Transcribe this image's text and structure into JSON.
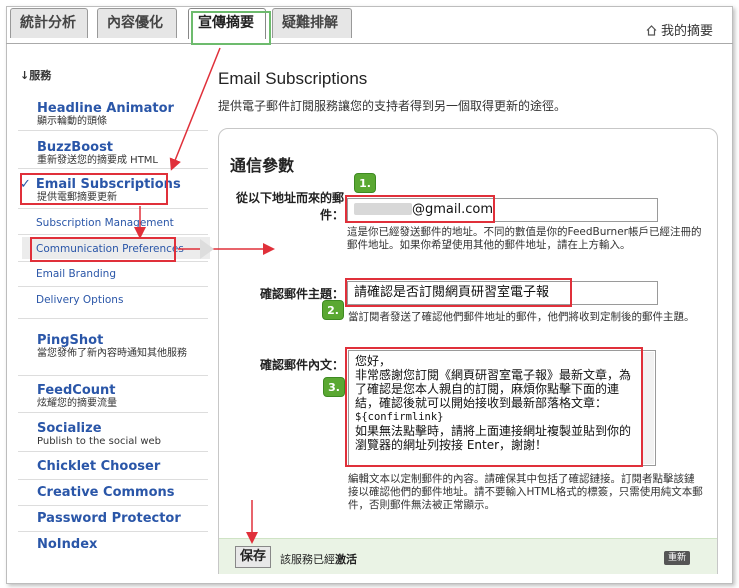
{
  "tabs": [
    {
      "label": "統計分析"
    },
    {
      "label": "內容優化"
    },
    {
      "label": "宣傳摘要"
    },
    {
      "label": "疑難排解"
    }
  ],
  "my_digest": "我的摘要",
  "sidebar": {
    "section_title": "↓服務",
    "services": [
      {
        "name": "Headline Animator",
        "desc": "顯示輪動的頭條"
      },
      {
        "name": "BuzzBoost",
        "desc": "重新發送您的摘要成 HTML"
      },
      {
        "name": "Email Subscriptions",
        "desc": "提供電郵摘要更新",
        "checked": "✓"
      },
      {
        "name": "PingShot",
        "desc": "當您發佈了新內容時通知其他服務"
      },
      {
        "name": "FeedCount",
        "desc": "炫耀您的摘要流量"
      },
      {
        "name": "Socialize",
        "desc": "Publish to the social web"
      },
      {
        "name": "Chicklet Chooser"
      },
      {
        "name": "Creative Commons"
      },
      {
        "name": "Password Protector"
      },
      {
        "name": "NoIndex"
      }
    ],
    "subitems": [
      {
        "label": "Subscription Management"
      },
      {
        "label": "Communication Preferences"
      },
      {
        "label": "Email Branding"
      },
      {
        "label": "Delivery Options"
      }
    ]
  },
  "main": {
    "title": "Email Subscriptions",
    "subtitle": "提供電子郵件訂閱服務讓您的支持者得到另一個取得更新的途徑。",
    "panel_title": "通信參數",
    "from_label": "從以下地址而來的郵件：",
    "from_value": "@gmail.com",
    "from_help": "這是你已經發送郵件的地址。不同的數值是你的FeedBurner帳戶已經注冊的郵件地址。如果你希望使用其他的郵件地址，請在上方輸入。",
    "subject_label": "確認郵件主題：",
    "subject_value": "請確認是否訂閱網頁研習室電子報",
    "subject_help": "當訂閱者發送了確認他們郵件地址的郵件，他們將收到定制後的郵件主題。",
    "body_label": "確認郵件內文：",
    "body_lines": [
      "您好，",
      "非常感謝您訂閱《網頁研習室電子報》最新文章，為了確認是您本人親自的訂閱，麻煩你點擊下面的連結，確認後就可以開始接收到最新部落格文章：",
      "${confirmlink}",
      "如果無法點擊時，請將上面連接網址複製並貼到你的瀏覽器的網址列按接 Enter，謝謝！"
    ],
    "body_help": "編輯文本以定制郵件的內容。請確保其中包括了確認鏈接。訂閱者點擊該鏈接以確認他們的郵件地址。請不要輸入HTML格式的標簽，只需使用純文本郵件，否則郵件無法被正常顯示。",
    "badges": [
      "1.",
      "2.",
      "3."
    ],
    "save_label": "保存",
    "status_prefix": "該服務已經",
    "status_value": "激活",
    "mini_button": "重新"
  },
  "colors": {
    "link": "#2a56a8",
    "highlight": "#e0303a",
    "badge": "#5aa832",
    "tab_active_border": "#6dbb6d"
  }
}
